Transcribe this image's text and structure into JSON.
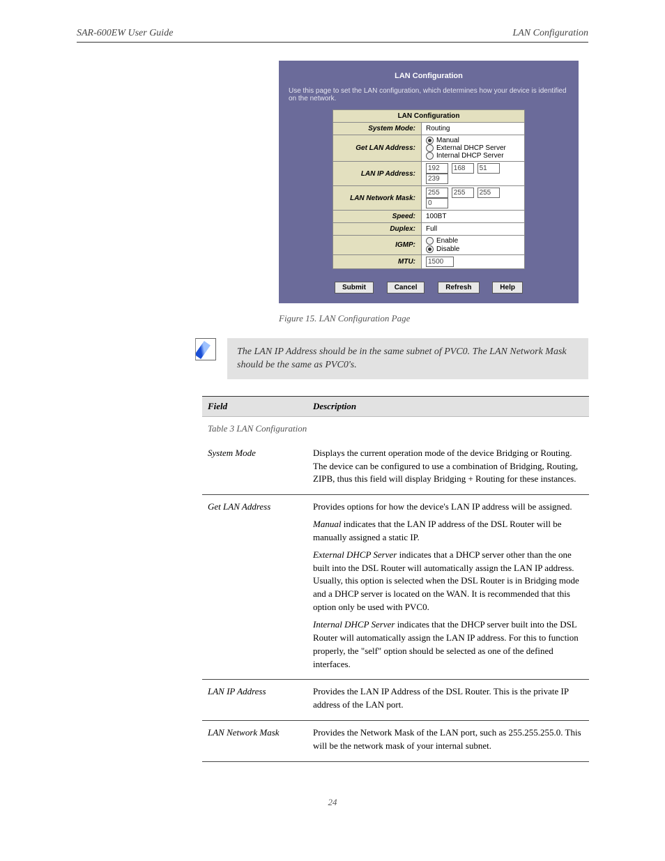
{
  "header": {
    "left": "SAR-600EW User Guide",
    "right": "LAN Configuration"
  },
  "screenshot": {
    "title": "LAN Configuration",
    "subtitle": "Use this page to set the LAN configuration, which determines how your device is identified on the network.",
    "table_header": "LAN Configuration",
    "rows": {
      "system_mode": {
        "label": "System Mode:",
        "value": "Routing"
      },
      "get_lan": {
        "label": "Get LAN Address:",
        "options": [
          "Manual",
          "External DHCP Server",
          "Internal DHCP Server"
        ],
        "selected": 0
      },
      "lan_ip": {
        "label": "LAN IP Address:",
        "octets": [
          "192",
          "168",
          "51",
          "239"
        ]
      },
      "netmask": {
        "label": "LAN Network Mask:",
        "octets": [
          "255",
          "255",
          "255",
          "0"
        ]
      },
      "speed": {
        "label": "Speed:",
        "value": "100BT"
      },
      "duplex": {
        "label": "Duplex:",
        "value": "Full"
      },
      "igmp": {
        "label": "IGMP:",
        "options": [
          "Enable",
          "Disable"
        ],
        "selected": 1
      },
      "mtu": {
        "label": "MTU:",
        "value": "1500"
      }
    },
    "buttons": [
      "Submit",
      "Cancel",
      "Refresh",
      "Help"
    ]
  },
  "figure_caption": "Figure 15. LAN Configuration Page",
  "note": "The LAN IP Address should be in the same subnet of PVC0. The LAN Network Mask should be the same as PVC0's.",
  "table3": {
    "caption": "Table 3 LAN Configuration",
    "head": [
      "Field",
      "Description"
    ],
    "rows": [
      {
        "field": "System Mode",
        "desc": "Displays the current operation mode of the device Bridging or Routing. The device can be configured to use a combination of Bridging, Routing, ZIPB, thus this field will display Bridging + Routing for these instances."
      },
      {
        "field": "Get LAN Address",
        "desc": "Provides options for how the device's LAN IP address will be assigned.",
        "options": [
          {
            "b": "Manual",
            "t": " indicates that the LAN IP address of the DSL Router will be manually assigned a static IP."
          },
          {
            "b": "External DHCP Server",
            "t": " indicates that a DHCP server other than the one built into the DSL Router will automatically assign the LAN IP address. Usually, this option is selected when the DSL Router is in Bridging mode and a DHCP server is located on the WAN. It is recommended that this option only be used with PVC0."
          },
          {
            "b": "Internal DHCP Server",
            "t": " indicates that the DHCP server built into the DSL Router will automatically assign the LAN IP address. For this to function properly, the \"self\" option should be selected as one of the defined interfaces."
          }
        ]
      },
      {
        "field": "LAN IP Address",
        "desc": "Provides the LAN IP Address of the DSL Router. This is the private IP address of the LAN port."
      },
      {
        "field": "LAN Network Mask",
        "desc": "Provides the Network Mask of the LAN port, such as 255.255.255.0. This will be the network mask of your internal subnet."
      }
    ]
  },
  "footer": "24"
}
